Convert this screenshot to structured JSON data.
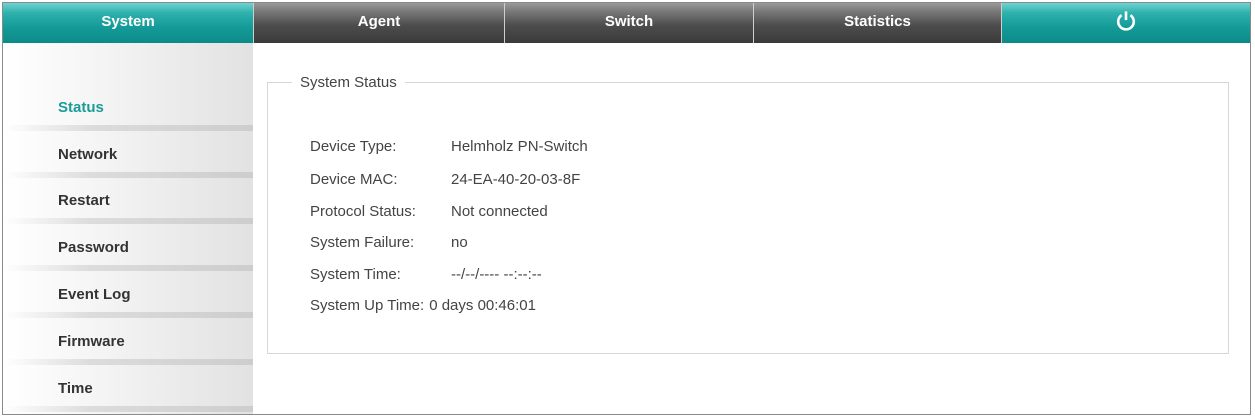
{
  "nav": {
    "tabs": [
      {
        "label": "System",
        "active": true
      },
      {
        "label": "Agent",
        "active": false
      },
      {
        "label": "Switch",
        "active": false
      },
      {
        "label": "Statistics",
        "active": false
      }
    ],
    "power_icon": "power-icon"
  },
  "sidebar": {
    "items": [
      {
        "label": "Status",
        "active": true
      },
      {
        "label": "Network"
      },
      {
        "label": "Restart"
      },
      {
        "label": "Password"
      },
      {
        "label": "Event Log"
      },
      {
        "label": "Firmware"
      },
      {
        "label": "Time"
      }
    ]
  },
  "status": {
    "title": "System Status",
    "rows": [
      {
        "label": "Device Type:",
        "value": "Helmholz PN-Switch"
      },
      {
        "label": "Device MAC:",
        "value": "24-EA-40-20-03-8F"
      },
      {
        "label": "Protocol Status:",
        "value": "Not connected"
      },
      {
        "label": "System Failure:",
        "value": "no"
      },
      {
        "label": "System Time:",
        "value": "--/--/---- --:--:--"
      },
      {
        "label": "System Up Time:",
        "value": "0 days 00:46:01"
      }
    ]
  },
  "colors": {
    "accent": "#1a9c98",
    "nav_dark": "#4d4d4d"
  }
}
